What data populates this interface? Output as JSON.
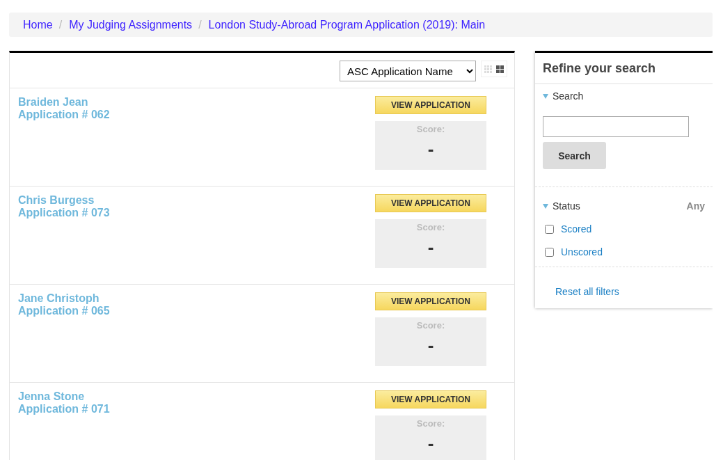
{
  "breadcrumb": [
    {
      "label": "Home"
    },
    {
      "label": "My Judging Assignments"
    },
    {
      "label": "London Study-Abroad Program Application (2019): Main"
    }
  ],
  "breadcrumb_separators": [
    "/",
    "/"
  ],
  "sort": {
    "value": "ASC Application Name"
  },
  "view_options": [
    {
      "kind": "small-grid",
      "selected": false
    },
    {
      "kind": "large-grid",
      "selected": true
    }
  ],
  "applications": [
    {
      "name": "Braiden Jean",
      "number": "Application # 062",
      "button": "VIEW APPLICATION",
      "score_label": "Score:",
      "score": "-"
    },
    {
      "name": "Chris Burgess",
      "number": "Application # 073",
      "button": "VIEW APPLICATION",
      "score_label": "Score:",
      "score": "-"
    },
    {
      "name": "Jane Christoph",
      "number": "Application # 065",
      "button": "VIEW APPLICATION",
      "score_label": "Score:",
      "score": "-"
    },
    {
      "name": "Jenna Stone",
      "number": "Application # 071",
      "button": "VIEW APPLICATION",
      "score_label": "Score:",
      "score": "-"
    }
  ],
  "sidebar": {
    "title": "Refine your search",
    "search_heading": "Search",
    "search_button": "Search",
    "status_heading": "Status",
    "status_value": "Any",
    "status_options": [
      {
        "label": "Scored",
        "checked": false
      },
      {
        "label": "Unscored",
        "checked": false
      }
    ],
    "reset": "Reset all filters"
  }
}
